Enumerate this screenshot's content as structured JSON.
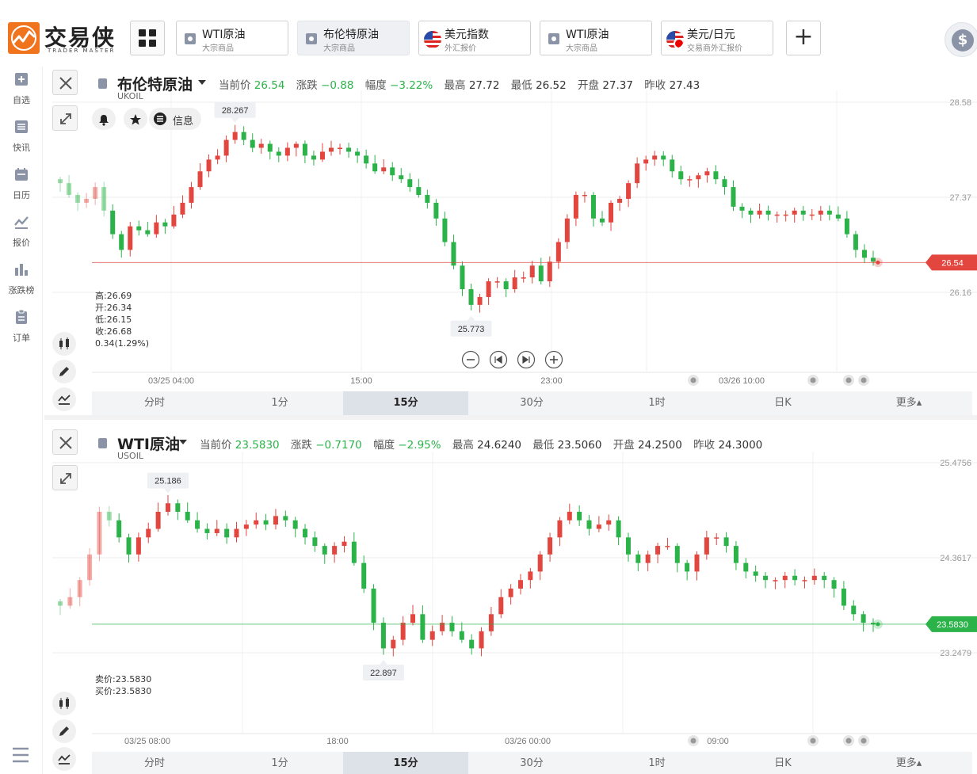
{
  "brand": {
    "name": "交易侠",
    "sub": "TRADER MASTER"
  },
  "tabs": [
    {
      "name": "WTI原油",
      "sub": "大宗商品",
      "icon": "commodity-icon",
      "active": false
    },
    {
      "name": "布伦特原油",
      "sub": "大宗商品",
      "icon": "commodity-icon",
      "active": true
    },
    {
      "name": "美元指数",
      "sub": "外汇报价",
      "icon": "us-flag-icon",
      "active": false
    },
    {
      "name": "WTI原油",
      "sub": "大宗商品",
      "icon": "commodity-icon",
      "active": false
    },
    {
      "name": "美元/日元",
      "sub": "交易商外汇报价",
      "icon": "usjp-flag-icon",
      "active": false
    }
  ],
  "sidebar": {
    "items": [
      {
        "label": "自选",
        "icon": "add-favorite-icon"
      },
      {
        "label": "快讯",
        "icon": "news-list-icon"
      },
      {
        "label": "日历",
        "icon": "calendar-icon"
      },
      {
        "label": "报价",
        "icon": "quote-line-icon"
      },
      {
        "label": "涨跌榜",
        "icon": "ranking-bars-icon"
      },
      {
        "label": "订单",
        "icon": "order-clipboard-icon"
      }
    ]
  },
  "colors": {
    "up": "#e2463f",
    "down": "#2bb34a",
    "accent": "#f0731e",
    "grid": "#ececec",
    "axis_text": "#999999"
  },
  "panels": [
    {
      "name": "布伦特原油",
      "code": "UKOIL",
      "stats": {
        "current_label": "当前价",
        "current": "26.54",
        "change_label": "涨跌",
        "change": "−0.88",
        "pct_label": "幅度",
        "pct": "−3.22%",
        "high_label": "最高",
        "high": "27.72",
        "low_label": "最低",
        "low": "26.52",
        "open_label": "开盘",
        "open": "27.37",
        "prev_label": "昨收",
        "prev": "27.43"
      },
      "info_label": "信息",
      "ohlc": [
        "高:26.69",
        "开:26.34",
        "低:26.15",
        "收:26.68",
        "0.34(1.29%)"
      ],
      "max_marker": "28.267",
      "min_marker": "25.773",
      "price_tag": "26.54",
      "y_ticks": [
        "28.58",
        "27.37",
        "26.16"
      ],
      "x_ticks": [
        "03/25 04:00",
        "15:00",
        "23:00",
        "03/26 10:00"
      ],
      "timeframes": [
        "分时",
        "1分",
        "15分",
        "30分",
        "1时",
        "日K",
        "更多▴"
      ],
      "active_timeframe": 2
    },
    {
      "name": "WTI原油",
      "code": "USOIL",
      "stats": {
        "current_label": "当前价",
        "current": "23.5830",
        "change_label": "涨跌",
        "change": "−0.7170",
        "pct_label": "幅度",
        "pct": "−2.95%",
        "high_label": "最高",
        "high": "24.6240",
        "low_label": "最低",
        "low": "23.5060",
        "open_label": "开盘",
        "open": "24.2500",
        "prev_label": "昨收",
        "prev": "24.3000"
      },
      "ohlc": [
        "卖价:23.5830",
        "买价:23.5830"
      ],
      "max_marker": "25.186",
      "min_marker": "22.897",
      "price_tag": "23.5830",
      "y_ticks": [
        "25.4756",
        "24.3617",
        "23.2479"
      ],
      "x_ticks": [
        "03/25 08:00",
        "18:00",
        "03/26 00:00",
        "09:00"
      ],
      "timeframes": [
        "分时",
        "1分",
        "15分",
        "30分",
        "1时",
        "日K",
        "更多▴"
      ],
      "active_timeframe": 2
    }
  ],
  "chart_data": [
    {
      "type": "candlestick",
      "title": "布伦特原油",
      "y_ticks": [
        28.58,
        27.37,
        26.16
      ],
      "x_ticks": [
        "03/25 04:00",
        "15:00",
        "23:00",
        "03/26 10:00"
      ],
      "last_price": 26.54,
      "marked_high": 28.267,
      "marked_low": 25.773,
      "close_path": [
        27.55,
        27.4,
        27.3,
        27.35,
        27.5,
        27.2,
        26.9,
        26.7,
        27.0,
        26.95,
        26.9,
        27.05,
        27.0,
        27.15,
        27.3,
        27.5,
        27.7,
        27.85,
        27.9,
        28.1,
        28.2,
        28.1,
        28.0,
        28.05,
        27.95,
        27.9,
        28.0,
        28.05,
        27.9,
        27.85,
        27.95,
        28.0,
        28.0,
        27.95,
        27.9,
        27.8,
        27.7,
        27.75,
        27.65,
        27.6,
        27.5,
        27.4,
        27.3,
        27.1,
        26.8,
        26.5,
        26.2,
        26.0,
        26.1,
        26.3,
        26.3,
        26.2,
        26.35,
        26.35,
        26.5,
        26.3,
        26.55,
        26.8,
        27.1,
        27.4,
        27.4,
        27.1,
        27.05,
        27.3,
        27.35,
        27.55,
        27.8,
        27.85,
        27.9,
        27.85,
        27.7,
        27.6,
        27.6,
        27.65,
        27.7,
        27.6,
        27.5,
        27.25,
        27.2,
        27.15,
        27.2,
        27.15,
        27.15,
        27.15,
        27.2,
        27.15,
        27.15,
        27.2,
        27.15,
        27.1,
        26.9,
        26.7,
        26.6,
        26.55
      ]
    },
    {
      "type": "candlestick",
      "title": "WTI原油",
      "y_ticks": [
        25.4756,
        24.3617,
        23.2479
      ],
      "x_ticks": [
        "03/25 08:00",
        "18:00",
        "03/26 00:00",
        "09:00"
      ],
      "last_price": 23.583,
      "marked_high": 25.186,
      "marked_low": 22.897,
      "close_path": [
        23.8,
        23.9,
        24.1,
        24.4,
        24.9,
        24.8,
        24.6,
        24.4,
        24.6,
        24.7,
        24.9,
        25.0,
        24.9,
        24.8,
        24.7,
        24.65,
        24.7,
        24.6,
        24.7,
        24.75,
        24.8,
        24.75,
        24.85,
        24.8,
        24.7,
        24.6,
        24.5,
        24.4,
        24.5,
        24.55,
        24.3,
        24.0,
        23.6,
        23.3,
        23.4,
        23.6,
        23.7,
        23.4,
        23.5,
        23.6,
        23.5,
        23.4,
        23.3,
        23.5,
        23.7,
        23.9,
        24.0,
        24.1,
        24.2,
        24.4,
        24.6,
        24.8,
        24.9,
        24.8,
        24.7,
        24.75,
        24.8,
        24.6,
        24.4,
        24.3,
        24.4,
        24.5,
        24.5,
        24.3,
        24.2,
        24.4,
        24.6,
        24.6,
        24.5,
        24.3,
        24.2,
        24.15,
        24.1,
        24.1,
        24.15,
        24.1,
        24.1,
        24.15,
        24.1,
        24.0,
        23.8,
        23.7,
        23.6,
        23.58
      ]
    }
  ]
}
